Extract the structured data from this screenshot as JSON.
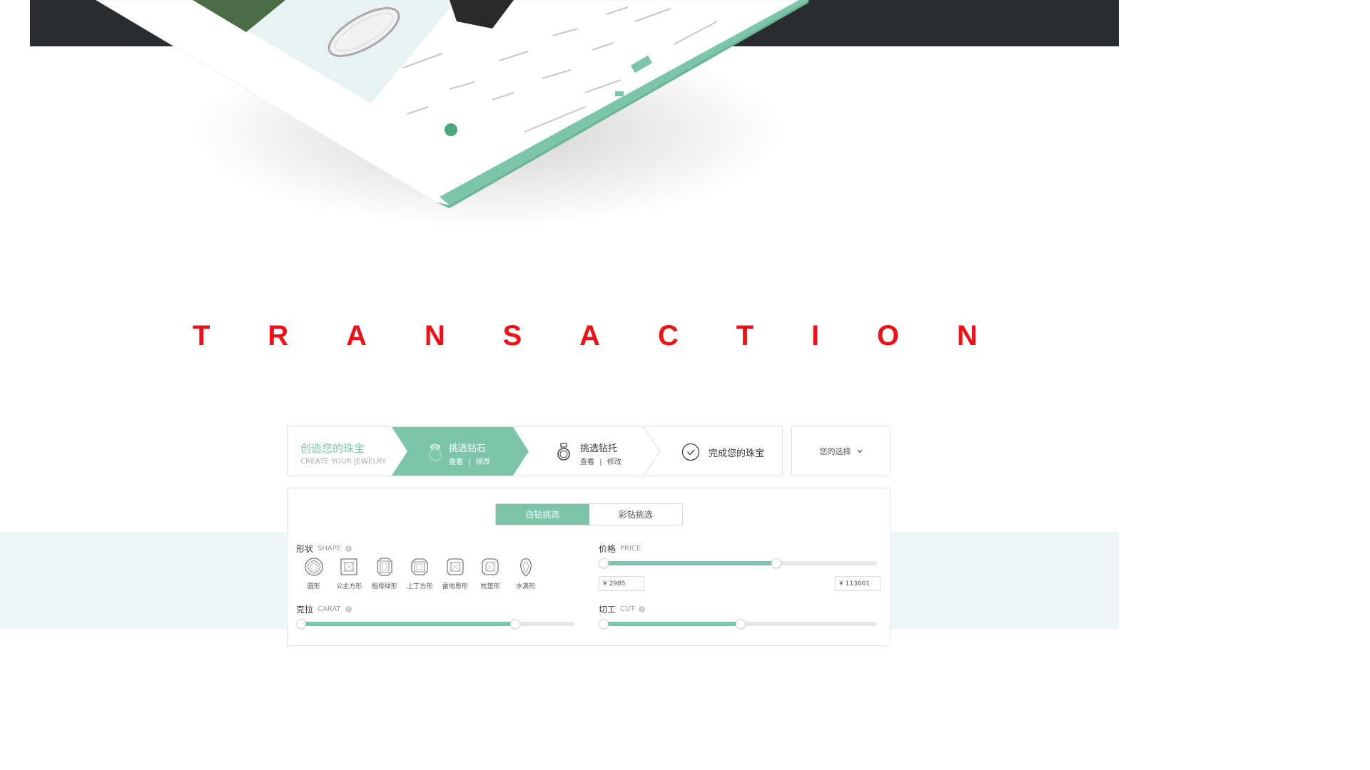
{
  "title_letters": [
    "T",
    "R",
    "A",
    "N",
    "S",
    "A",
    "C",
    "T",
    "I",
    "O",
    "N"
  ],
  "colors": {
    "accent": "#7cc5ab",
    "title_red": "#e8141a",
    "dark_banner": "#2b2c2e",
    "light_band": "#eef5f6"
  },
  "steps": {
    "create_zh": "创造您的珠宝",
    "create_en": "CREATE YOUR JEWELRY",
    "step1_title": "挑选钻石",
    "step1_view": "查看",
    "step1_sep": "|",
    "step1_edit": "修改",
    "step2_title": "挑选钻托",
    "step2_view": "查看",
    "step2_sep": "|",
    "step2_edit": "修改",
    "step3_title": "完成您的珠宝",
    "choice_label": "您的选择"
  },
  "tabs": {
    "white": "白钻挑选",
    "colored": "彩钻挑选"
  },
  "filters": {
    "shape_zh": "形状",
    "shape_en": "SHAPE",
    "price_zh": "价格",
    "price_en": "PRICE",
    "carat_zh": "克拉",
    "carat_en": "CARAT",
    "cut_zh": "切工",
    "cut_en": "CUT",
    "price_min": "¥ 2985",
    "price_max": "¥ 113601",
    "price_slider_fraction": 0.63,
    "carat_slider_fraction": 0.78,
    "cut_slider_fraction": 0.5
  },
  "shapes": [
    "圆形",
    "公主方形",
    "祖母绿形",
    "上丁方形",
    "雷地恩形",
    "枕垫形",
    "水滴形"
  ]
}
